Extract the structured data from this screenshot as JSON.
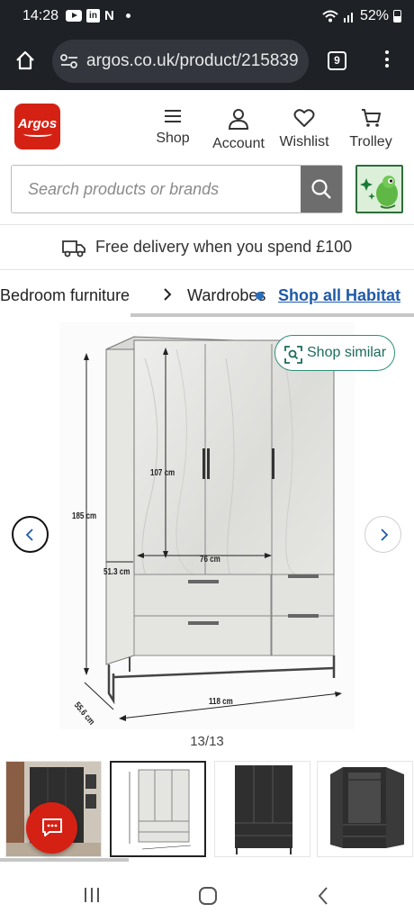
{
  "status_bar": {
    "time": "14:28",
    "notif_n": "N",
    "linkedin": "in",
    "battery": "52%"
  },
  "browser": {
    "url": "argos.co.uk/product/215839",
    "tab_count": "9"
  },
  "header": {
    "logo_text": "Argos",
    "nav": {
      "shop": "Shop",
      "account": "Account",
      "wishlist": "Wishlist",
      "trolley": "Trolley"
    }
  },
  "search": {
    "placeholder": "Search products or brands"
  },
  "delivery": {
    "text": "Free delivery when you spend £100"
  },
  "breadcrumbs": {
    "items": [
      "Bedroom furniture",
      "Wardrobes"
    ],
    "link": "Shop all Habitat"
  },
  "gallery": {
    "shop_similar": "Shop similar",
    "counter": "13/13",
    "dimensions": {
      "height": "185 cm",
      "inner_height": "107 cm",
      "inner_width": "76 cm",
      "depth_inner": "51.3 cm",
      "depth": "55.6 cm",
      "width": "118 cm"
    }
  },
  "colors": {
    "brand_red": "#d42114",
    "link_blue": "#1e5aa8",
    "similar_green": "#2d8f7a"
  }
}
